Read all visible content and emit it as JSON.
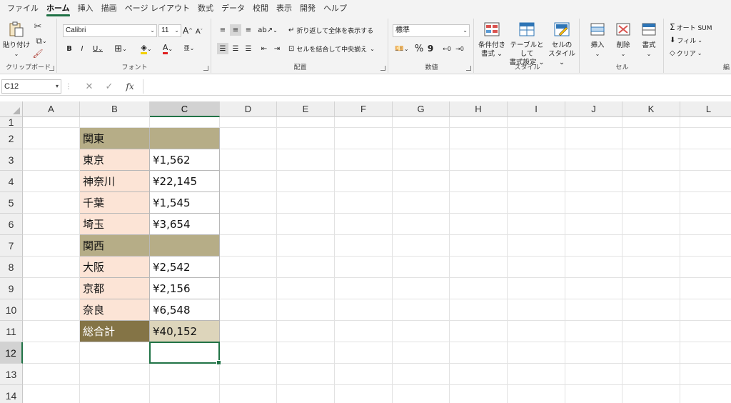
{
  "menu_tabs": [
    "ファイル",
    "ホーム",
    "挿入",
    "描画",
    "ページ レイアウト",
    "数式",
    "データ",
    "校閲",
    "表示",
    "開発",
    "ヘルプ"
  ],
  "active_tab": "ホーム",
  "ribbon": {
    "clipboard": {
      "label": "クリップボード",
      "paste": "貼り付け"
    },
    "font": {
      "label": "フォント",
      "font_name": "Calibri",
      "font_size": "11",
      "bold": "B",
      "italic": "I",
      "underline": "U",
      "grow": "A",
      "shrink": "A",
      "font_color": "A",
      "phonetic": "亜"
    },
    "alignment": {
      "label": "配置",
      "wrap_text": "折り返して全体を表示する",
      "merge_center": "セルを結合して中央揃え"
    },
    "number": {
      "label": "数値",
      "format": "標準",
      "percent": "%",
      "comma": "9"
    },
    "styles": {
      "label": "スタイル",
      "conditional": [
        "条件付き",
        "書式"
      ],
      "table": [
        "テーブルとして",
        "書式設定"
      ],
      "cell": [
        "セルの",
        "スタイル"
      ]
    },
    "cells": {
      "label": "セル",
      "insert": "挿入",
      "delete": "削除",
      "format": "書式"
    },
    "editing": {
      "label": "編",
      "autosum": "オート SUM",
      "fill": "フィル",
      "clear": "クリア"
    }
  },
  "formula_bar": {
    "name_box": "C12",
    "fx": "fx",
    "content": ""
  },
  "columns": [
    "A",
    "B",
    "C",
    "D",
    "E",
    "F",
    "G",
    "H",
    "I",
    "J",
    "K",
    "L"
  ],
  "selected_column": "C",
  "rows": [
    "1",
    "2",
    "3",
    "4",
    "5",
    "6",
    "7",
    "8",
    "9",
    "10",
    "11",
    "12",
    "13",
    "14"
  ],
  "selected_row": "12",
  "table": [
    {
      "row": "2",
      "b": "関東",
      "c": "",
      "type": "header"
    },
    {
      "row": "3",
      "b": "東京",
      "c": "¥1,562",
      "type": "item"
    },
    {
      "row": "4",
      "b": "神奈川",
      "c": "¥22,145",
      "type": "item"
    },
    {
      "row": "5",
      "b": "千葉",
      "c": "¥1,545",
      "type": "item"
    },
    {
      "row": "6",
      "b": "埼玉",
      "c": "¥3,654",
      "type": "item"
    },
    {
      "row": "7",
      "b": "関西",
      "c": "",
      "type": "header"
    },
    {
      "row": "8",
      "b": "大阪",
      "c": "¥2,542",
      "type": "item"
    },
    {
      "row": "9",
      "b": "京都",
      "c": "¥2,156",
      "type": "item"
    },
    {
      "row": "10",
      "b": "奈良",
      "c": "¥6,548",
      "type": "item"
    },
    {
      "row": "11",
      "b": "総合計",
      "c": "¥40,152",
      "type": "total"
    }
  ],
  "colors": {
    "header_fill": "#b6ad87",
    "item_label_fill": "#fce4d6",
    "total_label_fill": "#847446",
    "total_value_fill": "#ddd5bb",
    "excel_green": "#217346"
  }
}
